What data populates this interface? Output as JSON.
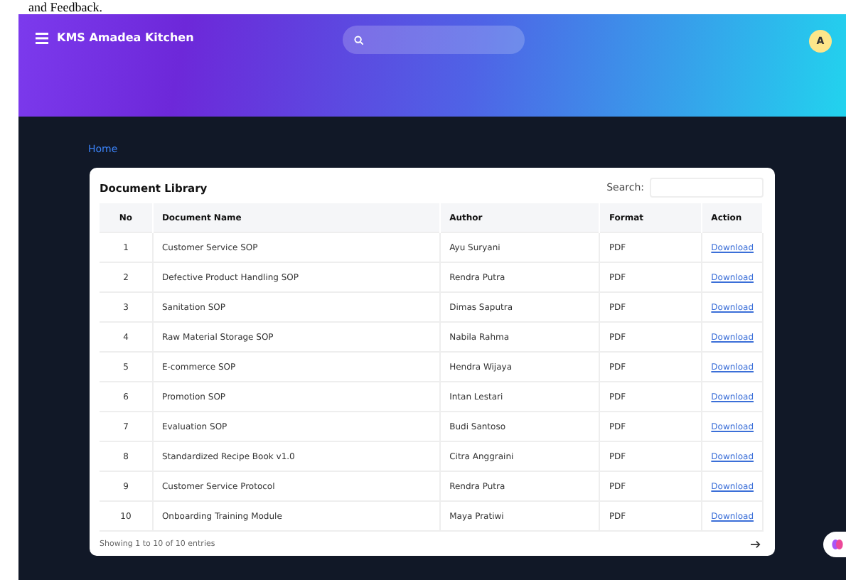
{
  "caption": "and Feedback.",
  "topbar": {
    "brand": "KMS Amadea Kitchen",
    "avatar": "A"
  },
  "breadcrumb": "Home",
  "library": {
    "title": "Document Library",
    "search_label": "Search:",
    "columns": [
      "No",
      "Document Name",
      "Author",
      "Format",
      "Action"
    ],
    "rows": [
      {
        "no": "1",
        "name": "Customer Service SOP",
        "author": "Ayu Suryani",
        "format": "PDF",
        "action": "Download"
      },
      {
        "no": "2",
        "name": "Defective Product Handling SOP",
        "author": "Rendra Putra",
        "format": "PDF",
        "action": "Download"
      },
      {
        "no": "3",
        "name": "Sanitation SOP",
        "author": "Dimas Saputra",
        "format": "PDF",
        "action": "Download"
      },
      {
        "no": "4",
        "name": "Raw Material Storage SOP",
        "author": "Nabila Rahma",
        "format": "PDF",
        "action": "Download"
      },
      {
        "no": "5",
        "name": "E-commerce SOP",
        "author": "Hendra Wijaya",
        "format": "PDF",
        "action": "Download"
      },
      {
        "no": "6",
        "name": "Promotion SOP",
        "author": "Intan Lestari",
        "format": "PDF",
        "action": "Download"
      },
      {
        "no": "7",
        "name": "Evaluation SOP",
        "author": "Budi Santoso",
        "format": "PDF",
        "action": "Download"
      },
      {
        "no": "8",
        "name": "Standardized Recipe Book v1.0",
        "author": "Citra Anggraini",
        "format": "PDF",
        "action": "Download"
      },
      {
        "no": "9",
        "name": "Customer Service Protocol",
        "author": "Rendra Putra",
        "format": "PDF",
        "action": "Download"
      },
      {
        "no": "10",
        "name": "Onboarding Training Module",
        "author": "Maya Pratiwi",
        "format": "PDF",
        "action": "Download"
      }
    ],
    "footer": "Showing 1 to 10 of 10 entries"
  }
}
